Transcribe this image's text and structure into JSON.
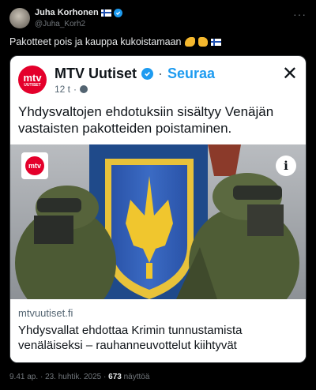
{
  "author": {
    "name": "Juha Korhonen",
    "handle": "@Juha_Korh2"
  },
  "post": {
    "text": "Pakotteet pois ja kauppa kukoistamaan",
    "emojis": [
      "muscle-emoji",
      "thumbs-up-emoji",
      "finland-flag-emoji"
    ]
  },
  "embedded": {
    "logo_text": "mtv",
    "logo_subtext": "UUTISET",
    "account": "MTV Uutiset",
    "follow_label": "Seuraa",
    "age": "12 t",
    "separator": "·",
    "text": "Yhdysvaltojen ehdotuksiin sisältyy Venäjän vastaisten pakotteiden poistaminen.",
    "badge_text": "mtv",
    "info_label": "i",
    "link_domain": "mtvuutiset.fi",
    "link_title": "Yhdysvallat ehdottaa Krimin tunnustamista venäläiseksi – rauhanneuvottelut kiihtyvät"
  },
  "footer": {
    "time": "9.41 ap.",
    "dot": "·",
    "date": "23. huhtik. 2025",
    "views_count": "673",
    "views_label": "näyttöä"
  },
  "colors": {
    "background": "#000000",
    "accent": "#1d9bf0",
    "mtv_red": "#e4002b",
    "muted": "#71767b"
  }
}
